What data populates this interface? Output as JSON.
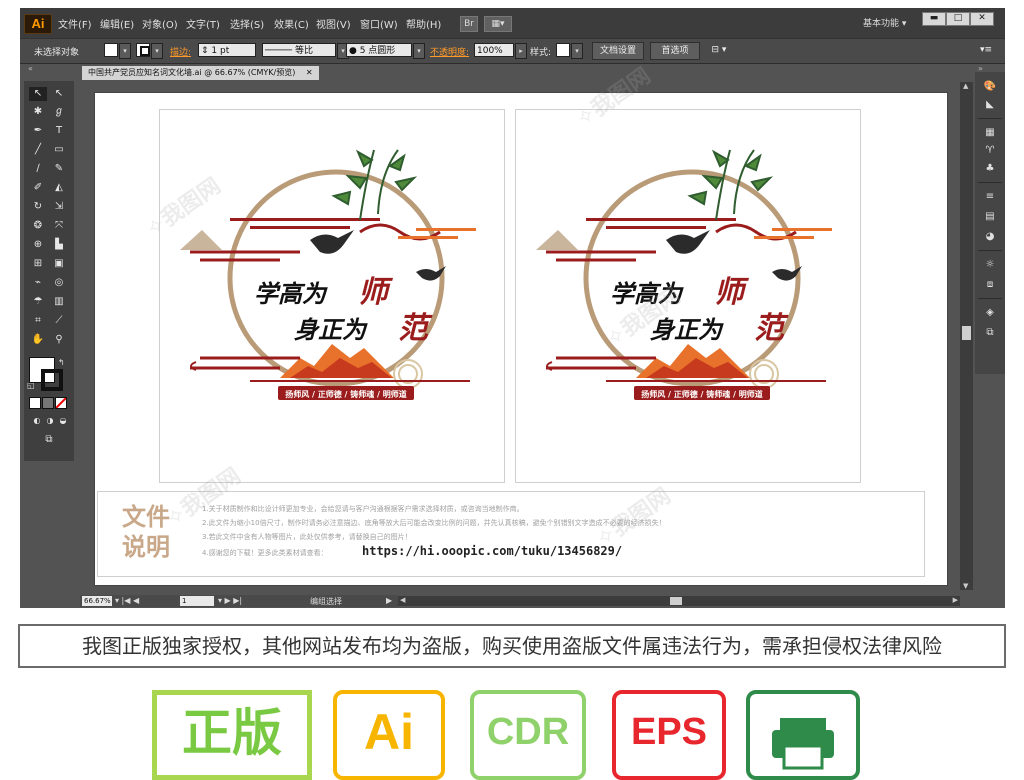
{
  "app": {
    "logo": "Ai"
  },
  "menu": [
    "文件(F)",
    "编辑(E)",
    "对象(O)",
    "文字(T)",
    "选择(S)",
    "效果(C)",
    "视图(V)",
    "窗口(W)",
    "帮助(H)"
  ],
  "menubar_buttons": [
    "Br"
  ],
  "workspace": "基本功能",
  "window_controls": [
    "▬",
    "□",
    "✕"
  ],
  "control_bar": {
    "selection_status": "未选择对象",
    "stroke_label": "描边:",
    "stroke_value": "1 pt",
    "profile_value": "等比",
    "brush_value": "5 点圆形",
    "opacity_label": "不透明度:",
    "opacity_value": "100%",
    "style_label": "样式:",
    "doc_setup": "文档设置",
    "preferences": "首选项"
  },
  "document": {
    "tab_title": "中国共产党员应知名词文化墙.ai @ 66.67% (CMYK/预览)",
    "tab_close": "✕"
  },
  "artboard": {
    "slogan_line1_black": "学高为",
    "slogan_line1_red": "师",
    "slogan_line2_black": "身正为",
    "slogan_line2_red": "范",
    "ribbon": "扬师风 / 正师德 / 铸师魂 / 明师道"
  },
  "notes": {
    "title": "文件说明",
    "lines": [
      "1.关于材质制作和比设计师更加专业，会给您请与客户沟通根据客户需求选择材质，或咨询当地制作商。",
      "2.此文件为缩小10倍尺寸，制作时请务必注意描边、底角等放大后可能会改变比例的问题，并先认真核稿，避免个别错别文字造成不必要的经济损失！",
      "3.若此文件中含有人物等图片，此处仅供参考，请替换自己的图片！",
      "4.感谢您的下载！更多此类素材请查看："
    ],
    "url": "https://hi.ooopic.com/tuku/13456829/"
  },
  "status": {
    "zoom": "66.67%",
    "page": "1",
    "mode": "编组选择"
  },
  "notice": "我图正版独家授权，其他网站发布均为盗版，购买使用盗版文件属违法行为，需承担侵权法律风险",
  "badges": [
    {
      "label": "正版",
      "color": "#7ac943"
    },
    {
      "label": "Ai",
      "color": "#f7b500"
    },
    {
      "label": "CDR",
      "color": "#8fd16a"
    },
    {
      "label": "EPS",
      "color": "#e8262d"
    }
  ],
  "colors": {
    "accent_red": "#9b1c1c",
    "orange": "#e8712b",
    "tan": "#c8a889",
    "gold_ring": "#b99b78"
  },
  "icons": [
    "selection-tool-icon",
    "direct-selection-icon",
    "magic-wand-icon",
    "lasso-icon",
    "pen-icon",
    "type-icon",
    "line-icon",
    "rectangle-icon",
    "paintbrush-icon",
    "pencil-icon",
    "blob-brush-icon",
    "eraser-icon",
    "rotate-icon",
    "scale-icon",
    "warp-icon",
    "free-transform-icon",
    "shape-builder-icon",
    "perspective-icon",
    "mesh-icon",
    "gradient-icon",
    "eyedropper-icon",
    "blend-icon",
    "symbol-sprayer-icon",
    "column-graph-icon",
    "artboard-tool-icon",
    "slice-icon",
    "hand-icon",
    "zoom-icon",
    "printer-icon"
  ]
}
